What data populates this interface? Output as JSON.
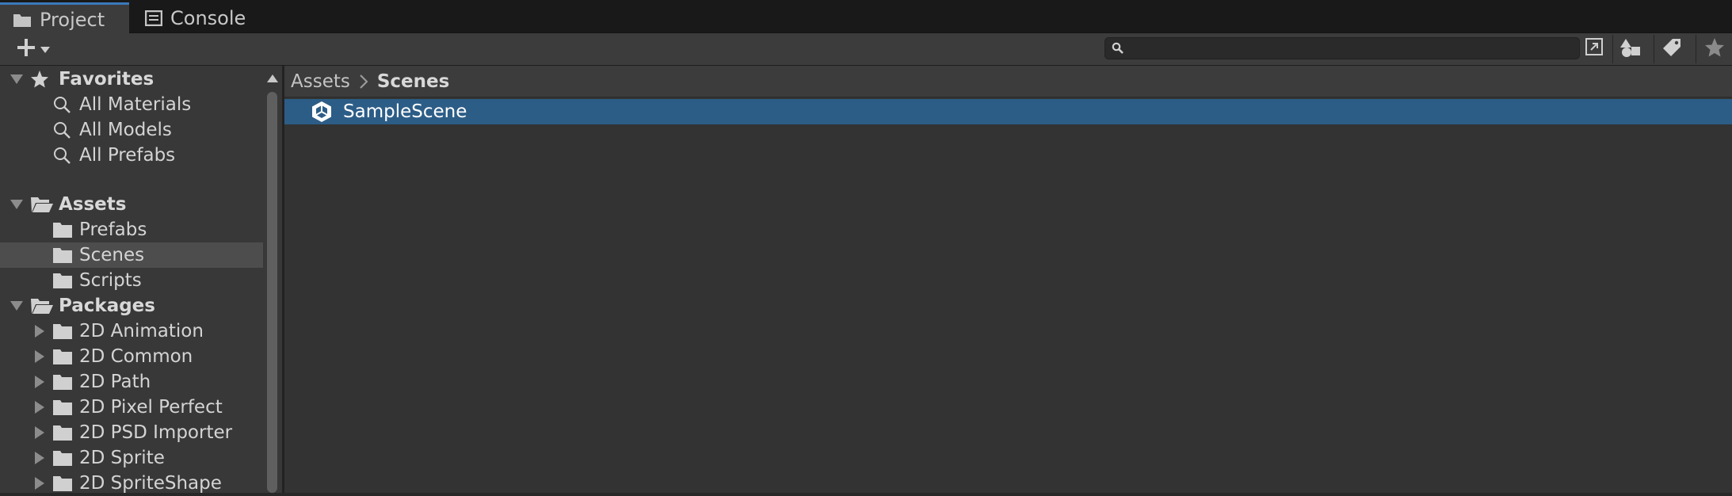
{
  "tabs": [
    {
      "label": "Project",
      "icon": "folder-icon",
      "active": true
    },
    {
      "label": "Console",
      "icon": "console-icon",
      "active": false
    }
  ],
  "toolbar": {
    "create_icon": "plus-icon",
    "search_value": "",
    "search_placeholder": ""
  },
  "tree": {
    "favorites": {
      "label": "Favorites",
      "items": [
        "All Materials",
        "All Models",
        "All Prefabs"
      ]
    },
    "assets": {
      "label": "Assets",
      "items": [
        "Prefabs",
        "Scenes",
        "Scripts"
      ],
      "selected": "Scenes"
    },
    "packages": {
      "label": "Packages",
      "items": [
        "2D Animation",
        "2D Common",
        "2D Path",
        "2D Pixel Perfect",
        "2D PSD Importer",
        "2D Sprite",
        "2D SpriteShape"
      ]
    }
  },
  "breadcrumb": [
    "Assets",
    "Scenes"
  ],
  "files": [
    {
      "name": "SampleScene",
      "icon": "unity-scene-icon",
      "selected": true
    }
  ],
  "colors": {
    "accent": "#3a79bb",
    "selection": "#2c5d87",
    "panel": "#383838",
    "main": "#333333"
  }
}
